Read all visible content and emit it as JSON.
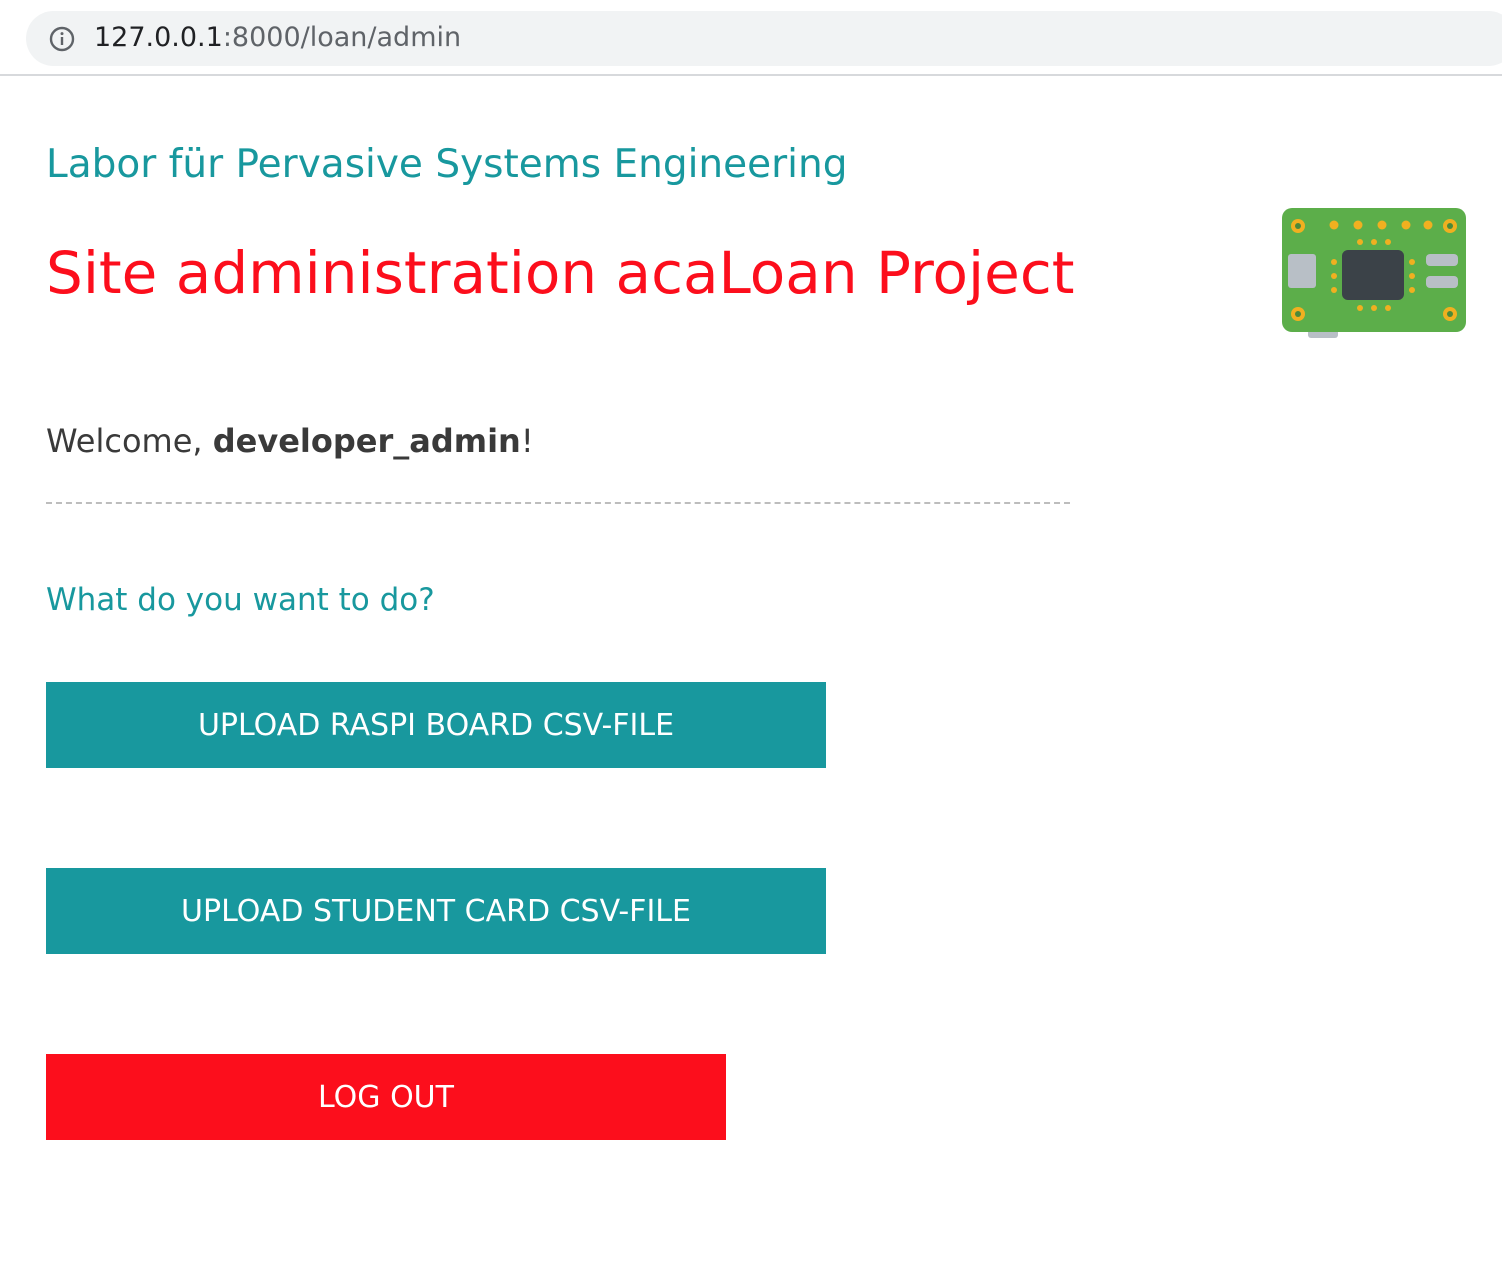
{
  "browser": {
    "url_host": "127.0.0.1",
    "url_path": ":8000/loan/admin",
    "info_icon": "info-circle-icon"
  },
  "header": {
    "lab_title": "Labor für Pervasive Systems Engineering",
    "site_title": "Site administration acaLoan Project",
    "logo_icon": "raspberry-pi-board-icon"
  },
  "welcome": {
    "prefix": "Welcome, ",
    "username": "developer_admin",
    "suffix": "!"
  },
  "actions": {
    "question": "What do you want to do?",
    "upload_raspi_label": "UPLOAD RASPI BOARD CSV-FILE",
    "upload_student_label": "UPLOAD STUDENT CARD CSV-FILE",
    "logout_label": "LOG OUT"
  },
  "colors": {
    "accent_teal": "#18989e",
    "accent_red": "#fc0e1c",
    "text_dark": "#3a3a3a"
  }
}
